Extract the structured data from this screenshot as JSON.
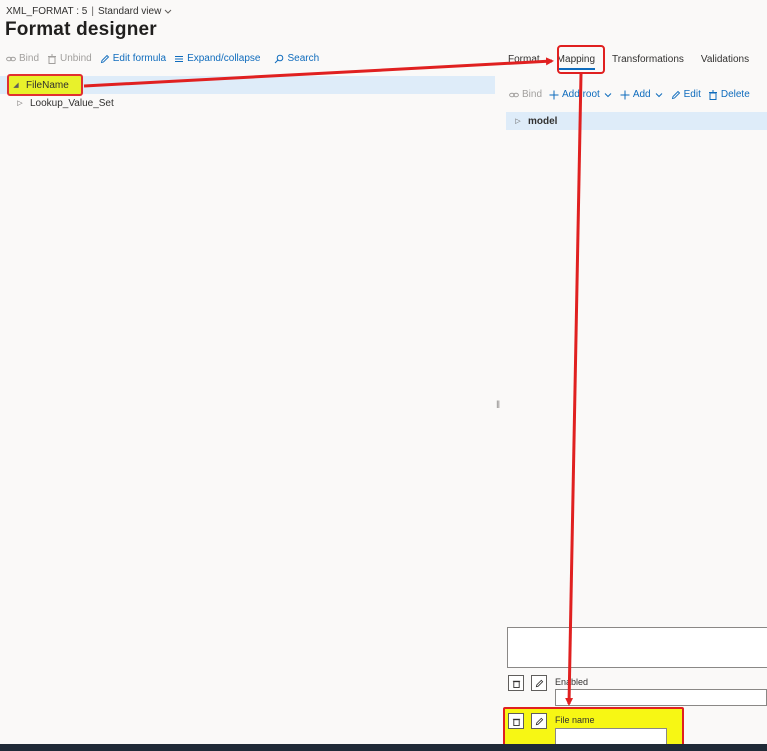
{
  "header": {
    "format_name": "XML_FORMAT : 5",
    "separator": "|",
    "view_label": "Standard view",
    "title": "Format designer"
  },
  "left_toolbar": {
    "bind": "Bind",
    "unbind": "Unbind",
    "edit_formula": "Edit formula",
    "expand_collapse": "Expand/collapse",
    "search": "Search"
  },
  "format_tree": [
    {
      "label": "FileName",
      "expanded": true,
      "selected": true
    },
    {
      "label": "Lookup_Value_Set",
      "expanded": false,
      "selected": false
    }
  ],
  "tabs": [
    {
      "label": "Format",
      "active": false
    },
    {
      "label": "Mapping",
      "active": true
    },
    {
      "label": "Transformations",
      "active": false
    },
    {
      "label": "Validations",
      "active": false
    }
  ],
  "right_toolbar": {
    "bind": "Bind",
    "add_root": "Add root",
    "add": "Add",
    "edit": "Edit",
    "delete": "Delete"
  },
  "model_tree": [
    {
      "label": "model",
      "expanded": false,
      "selected": true
    }
  ],
  "form": {
    "enabled_label": "Enabled",
    "enabled_value": "",
    "file_name_label": "File name",
    "file_name_value": ""
  },
  "colors": {
    "accent": "#0f6cbd",
    "selection": "#deecf9",
    "highlight": "#f7f714",
    "annotation": "#e02020"
  },
  "icons": {
    "bind": "link-icon",
    "unbind": "trash-icon",
    "edit_formula": "pencil-icon",
    "expand_collapse": "list-icon",
    "search": "search-icon",
    "add": "plus-icon",
    "chevron": "chevron-down-icon"
  }
}
